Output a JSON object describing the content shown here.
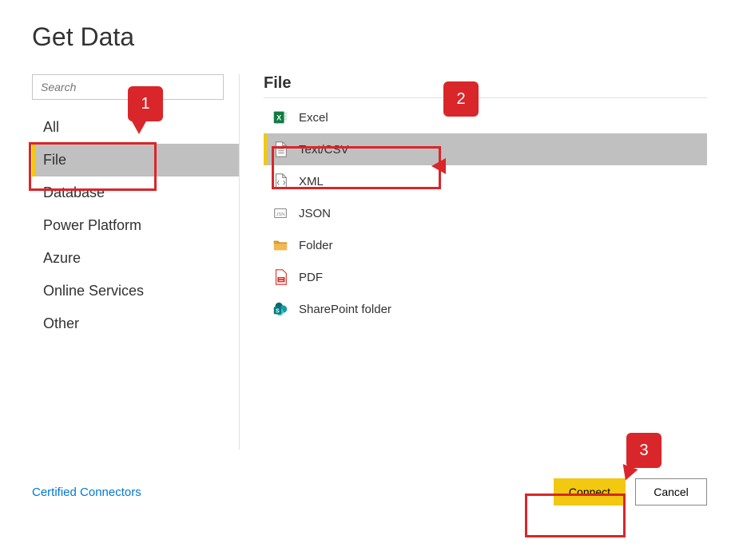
{
  "dialog": {
    "title": "Get Data"
  },
  "search": {
    "placeholder": "Search"
  },
  "categories": [
    {
      "label": "All"
    },
    {
      "label": "File",
      "selected": true
    },
    {
      "label": "Database"
    },
    {
      "label": "Power Platform"
    },
    {
      "label": "Azure"
    },
    {
      "label": "Online Services"
    },
    {
      "label": "Other"
    }
  ],
  "section_heading": "File",
  "connectors": [
    {
      "label": "Excel",
      "icon": "excel-icon"
    },
    {
      "label": "Text/CSV",
      "icon": "textcsv-icon",
      "selected": true
    },
    {
      "label": "XML",
      "icon": "xml-icon"
    },
    {
      "label": "JSON",
      "icon": "json-icon"
    },
    {
      "label": "Folder",
      "icon": "folder-icon"
    },
    {
      "label": "PDF",
      "icon": "pdf-icon"
    },
    {
      "label": "SharePoint folder",
      "icon": "sharepoint-icon"
    }
  ],
  "footer": {
    "certified_link": "Certified Connectors",
    "connect_label": "Connect",
    "cancel_label": "Cancel"
  },
  "annotations": [
    {
      "num": "1"
    },
    {
      "num": "2"
    },
    {
      "num": "3"
    }
  ]
}
